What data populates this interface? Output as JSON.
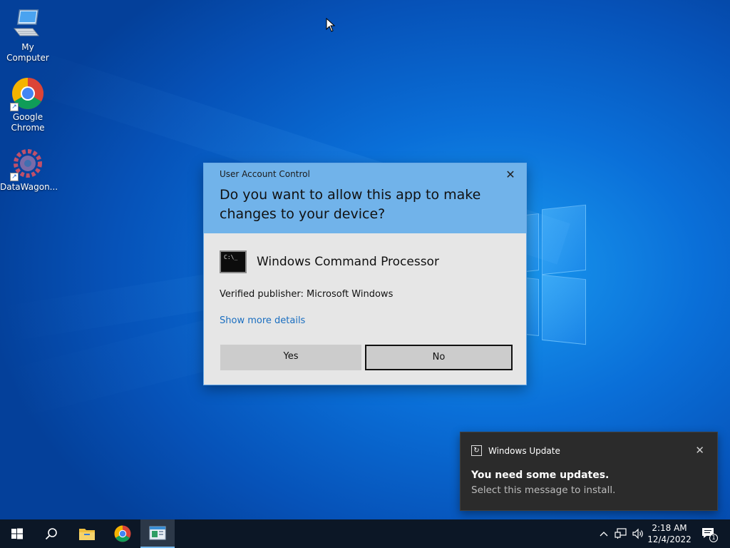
{
  "desktop_icons": [
    {
      "label": "My Computer",
      "icon": "computer-icon"
    },
    {
      "label": "Google\nChrome",
      "icon": "chrome-icon"
    },
    {
      "label": "DataWagon...",
      "icon": "datawagon-icon"
    }
  ],
  "uac": {
    "title": "User Account Control",
    "close_symbol": "✕",
    "question": "Do you want to allow this app to make changes to your device?",
    "app_icon_text": "C:\\_",
    "app_name": "Windows Command Processor",
    "publisher": "Verified publisher: Microsoft Windows",
    "details_link": "Show more details",
    "yes_label": "Yes",
    "no_label": "No"
  },
  "toast": {
    "app_name": "Windows Update",
    "app_icon": "update-icon",
    "close_symbol": "✕",
    "title": "You need some updates.",
    "message": "Select this message to install."
  },
  "taskbar": {
    "apps": [
      "start-icon",
      "search-icon",
      "file-explorer-icon",
      "chrome-icon",
      "active-app-icon"
    ],
    "clock_time": "2:18 AM",
    "clock_date": "12/4/2022",
    "notification_count": "1",
    "tray_up_symbol": "^"
  },
  "colors": {
    "uac_header": "#71b3ea",
    "link": "#1a6ec0",
    "taskbar": "#0c1726",
    "toast_bg": "#2b2b2b"
  }
}
